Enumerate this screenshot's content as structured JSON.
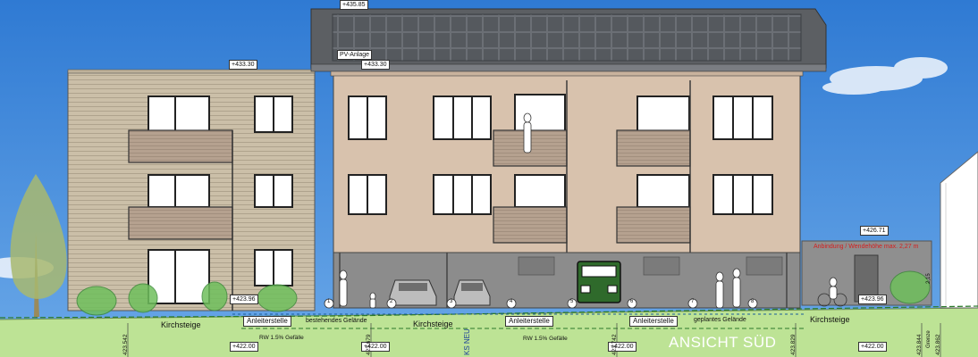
{
  "title": "ANSICHT SÜD",
  "levels": {
    "ridge": "+435.85",
    "left_eave": "+433.30",
    "main_eave": "+433.30",
    "right_wall": "+426.71",
    "ground_left": "+423.96",
    "ground_right": "+423.96",
    "base_1": "+422.00",
    "base_2": "+422.00",
    "base_3": "+422.00",
    "base_4": "+422.00"
  },
  "labels": {
    "pv": "PV-Anlage",
    "street_left": "Kirchsteige",
    "street_center": "Kirchsteige",
    "street_right": "Kirchsteige",
    "anleiter_1": "Anleiterstelle",
    "anleiter_2": "Anleiterstelle",
    "anleiter_3": "Anleiterstelle",
    "terrain_existing": "bestehendes Gelände",
    "terrain_planned": "geplantes Gelände",
    "rw_1": "RW 1.5% Gefälle",
    "rw_2": "RW 1.5% Gefälle",
    "ks_neu": "KS NEU",
    "red_note": "Anbindung / Wendehöhe max. 2,27 m",
    "grenze": "Grenze",
    "small_dim": "2,15"
  },
  "vertical_levels": [
    "423.542",
    "423.679",
    "423.742",
    "423.829",
    "423.844",
    "423.862"
  ],
  "parking_numbers": [
    "1",
    "2",
    "3",
    "4",
    "5",
    "6",
    "7",
    "8"
  ],
  "colors": {
    "sky": "#3f86d6",
    "grass": "#b9e08a",
    "wood": "#c9bda6",
    "render": "#d9c3ae",
    "roof": "#5f6266",
    "balcony": "#b7a391",
    "garage": "#8e8e8e"
  }
}
